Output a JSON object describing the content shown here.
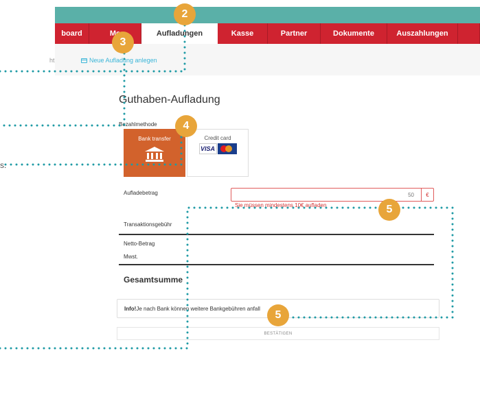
{
  "nav": {
    "tabs": [
      {
        "label": "board",
        "active": false
      },
      {
        "label": "Me",
        "active": false
      },
      {
        "label": "Aufladungen",
        "active": true
      },
      {
        "label": "Kasse",
        "active": false
      },
      {
        "label": "Partner",
        "active": false
      },
      {
        "label": "Dokumente",
        "active": false
      },
      {
        "label": "Auszahlungen",
        "active": false
      },
      {
        "label": "",
        "active": false
      }
    ]
  },
  "subnav": {
    "overview_label": "ht",
    "new_topup_label": "Neue Aufladung anlegen"
  },
  "edge_text": "s.",
  "form": {
    "title": "Guthaben-Aufladung",
    "payment_method_label": "Bezahlmethode",
    "payment_options": [
      {
        "label": "Bank transfer",
        "icon": "bank-icon",
        "selected": true
      },
      {
        "label": "Credit card",
        "icon": "visa-mastercard-logos",
        "selected": false
      }
    ],
    "amount_label": "Aufladebetrag",
    "amount_value": "50",
    "currency": "€",
    "amount_error": "Sie müssen mindestens 10€ aufladen",
    "transaction_fee_label": "Transaktionsgebühr",
    "net_amount_label": "Netto-Betrag",
    "vat_label": "Mwst.",
    "total_label": "Gesamtsumme",
    "info_bold": "Info!",
    "info_text": "Je nach Bank können weitere Bankgebühren anfall",
    "confirm_label": "BESTÄTIGEN"
  },
  "callouts": [
    "2",
    "3",
    "4",
    "5",
    "5"
  ],
  "colors": {
    "nav_red": "#cf2330",
    "teal_strip": "#5ab0a8",
    "bank_orange": "#d2622c",
    "callout_orange": "#e8a53a",
    "dotted_teal": "#1e9aa5",
    "error_red": "#d23030"
  }
}
